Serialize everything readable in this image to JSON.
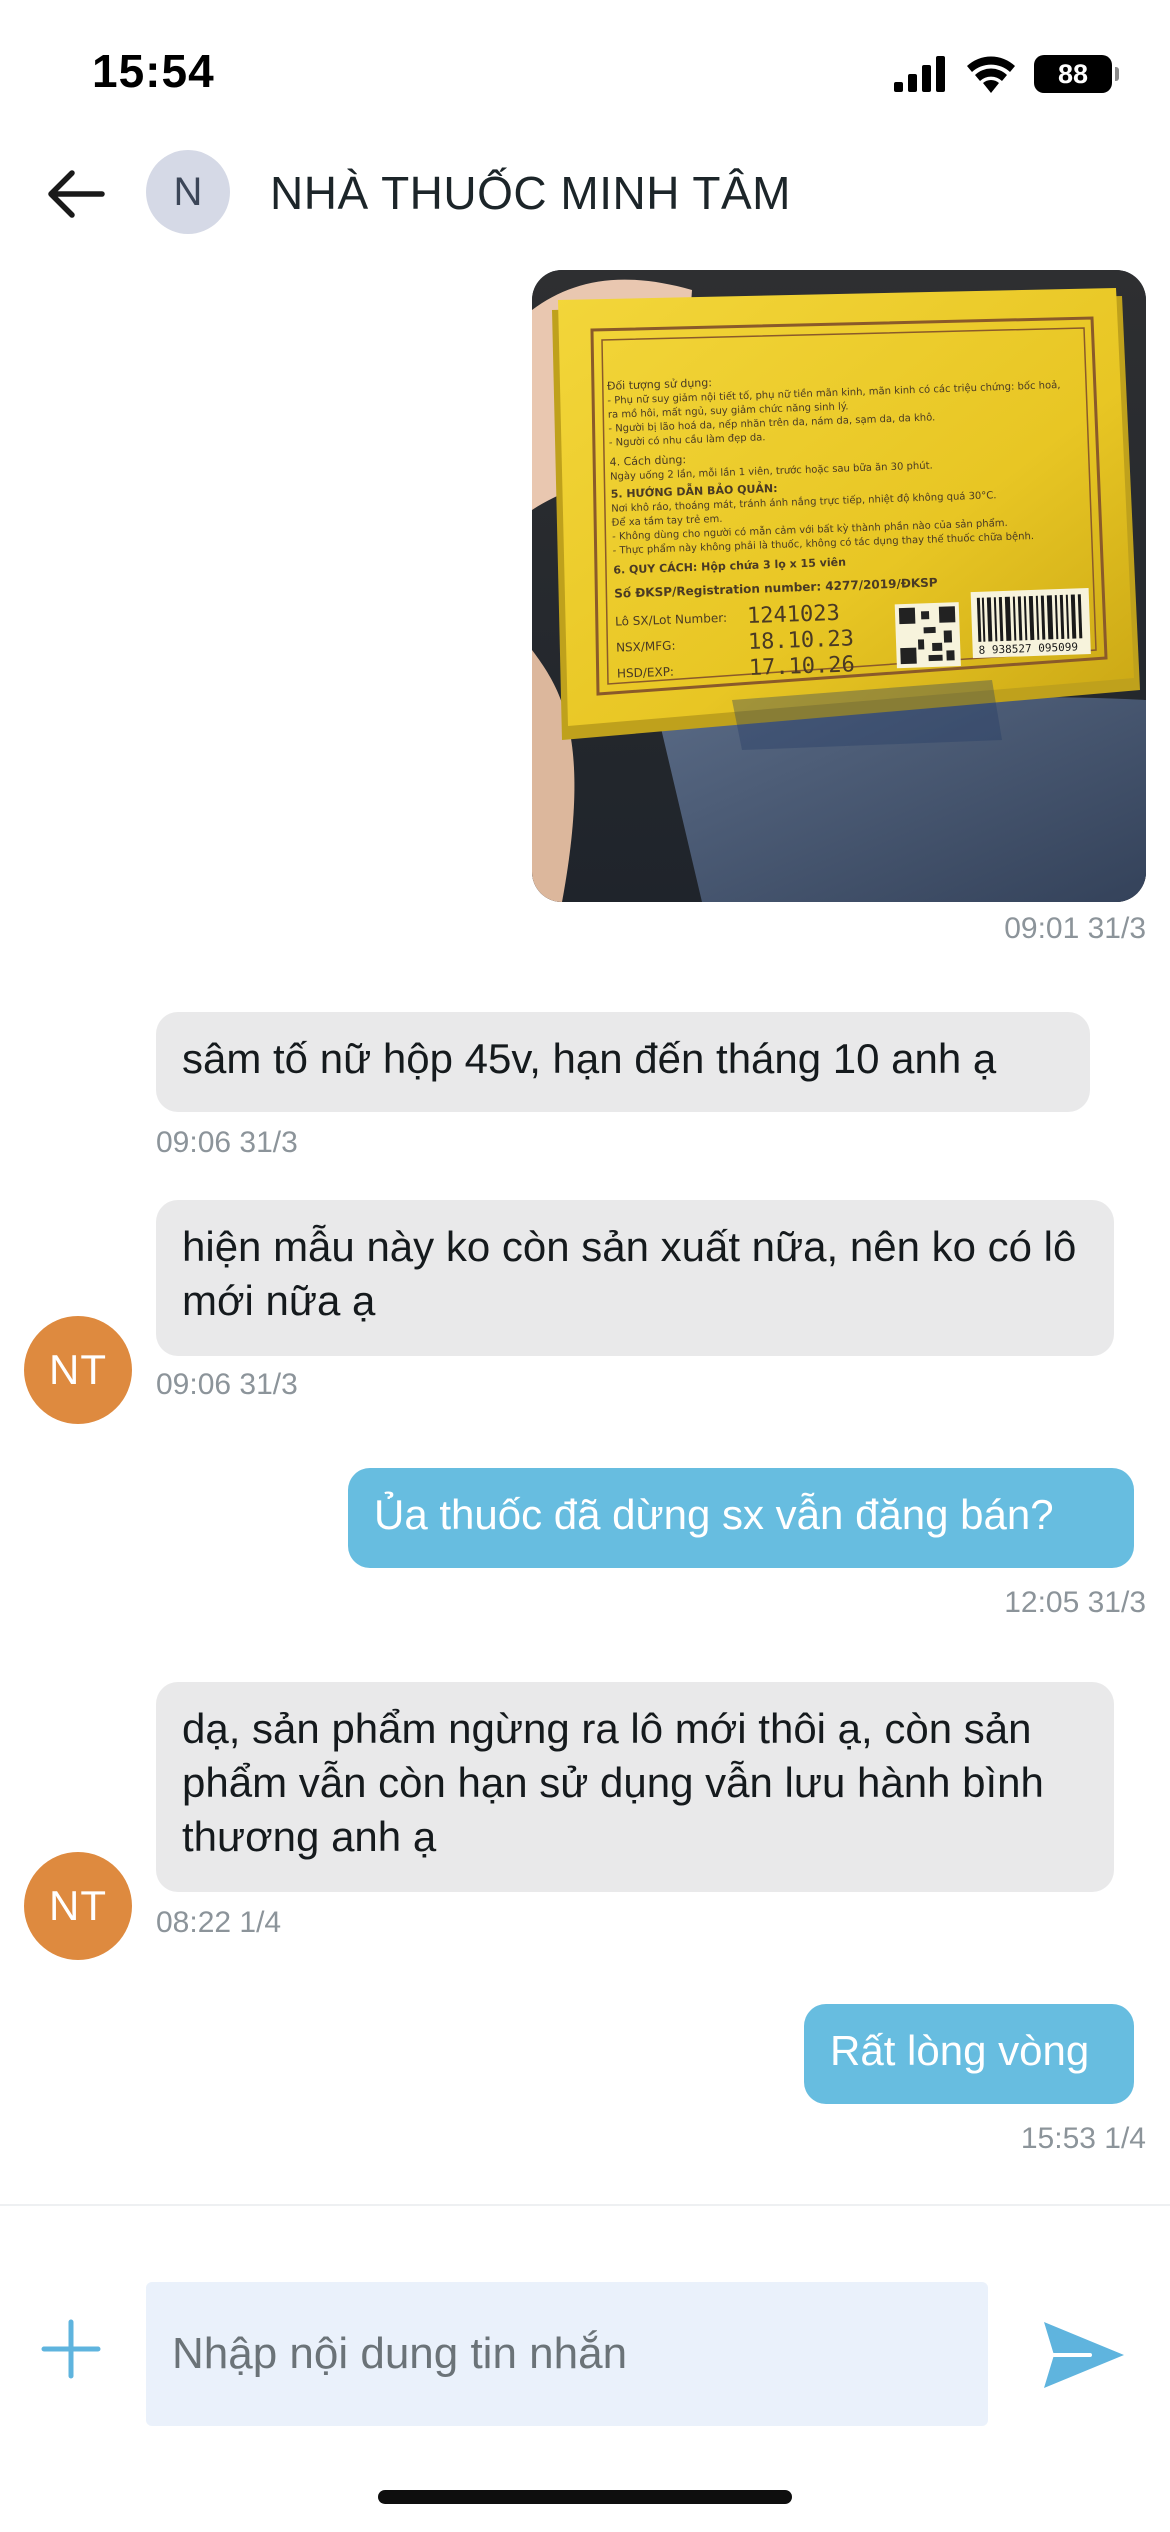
{
  "status_bar": {
    "time": "15:54",
    "battery": "88"
  },
  "header": {
    "avatar_initial": "N",
    "title": "NHÀ THUỐC MINH TÂM"
  },
  "photo": {
    "label_lines": [
      "Đối tượng sử dụng:",
      "- Phụ nữ suy giảm nội tiết tố, phụ nữ tiền mãn kinh, mãn kinh có các triệu chứng: bốc hoả,",
      "ra mồ hôi, mất ngủ, suy giảm chức năng sinh lý.",
      "- Người bị lão hoá da, nếp nhăn trên da, nám da, sạm da, da khô.",
      "- Người có nhu cầu làm đẹp da.",
      "4. Cách dùng:",
      "Ngày uống 2 lần, mỗi lần 1 viên, trước hoặc sau bữa ăn 30 phút.",
      "5. HƯỚNG DẪN BẢO QUẢN:",
      "Nơi khô ráo, thoáng mát, tránh ánh nắng trực tiếp, nhiệt độ không quá 30°C.",
      "Để xa tầm tay trẻ em.",
      "- Không dùng cho người có mẫn cảm với bất kỳ thành phần nào của sản phẩm.",
      "- Thực phẩm này không phải là thuốc, không có tác dụng thay thế thuốc chữa bệnh.",
      "6. QUY CÁCH: Hộp chứa 3 lọ x 15 viên"
    ],
    "registration": "Số ĐKSP/Registration number: 4277/2019/ĐKSP",
    "lot_label": "Lô SX/Lot Number:",
    "lot_value": "1241023",
    "mfg_label": "NSX/MFG:",
    "mfg_value": "18.10.23",
    "exp_label": "HSD/EXP:",
    "exp_value": "17.10.26",
    "barcode_number": "8 938527 095099"
  },
  "messages": [
    {
      "id": "m0",
      "side": "out",
      "type": "image",
      "time": "09:01 31/3"
    },
    {
      "id": "m1",
      "side": "in",
      "text": "sâm tố nữ hộp 45v, hạn đến tháng 10 anh ạ",
      "time": "09:06 31/3"
    },
    {
      "id": "m2",
      "side": "in",
      "text": "hiện mẫu này ko còn sản xuất nữa, nên ko có lô mới nữa ạ",
      "time": "09:06 31/3",
      "avatar": "NT"
    },
    {
      "id": "m3",
      "side": "out",
      "text": "Ủa thuốc đã dừng sx vẫn đăng bán?",
      "time": "12:05 31/3"
    },
    {
      "id": "m4",
      "side": "in",
      "text": "dạ, sản phẩm ngừng ra lô mới thôi ạ, còn sản phẩm vẫn còn hạn sử dụng vẫn lưu hành bình thương anh ạ",
      "time": "08:22 1/4",
      "avatar": "NT"
    },
    {
      "id": "m5",
      "side": "out",
      "text": "Rất lòng vòng",
      "time": "15:53 1/4"
    }
  ],
  "composer": {
    "placeholder": "Nhập nội dung tin nhắn"
  },
  "colors": {
    "accent": "#5fb4de",
    "incoming_bubble": "#e9e9ea",
    "outgoing_bubble": "#67bde0",
    "avatar_orange": "#de8a3f"
  },
  "icons": {
    "back": "arrow-left-icon",
    "add": "plus-icon",
    "send": "send-icon",
    "signal": "signal-icon",
    "wifi": "wifi-icon",
    "battery": "battery-icon"
  }
}
